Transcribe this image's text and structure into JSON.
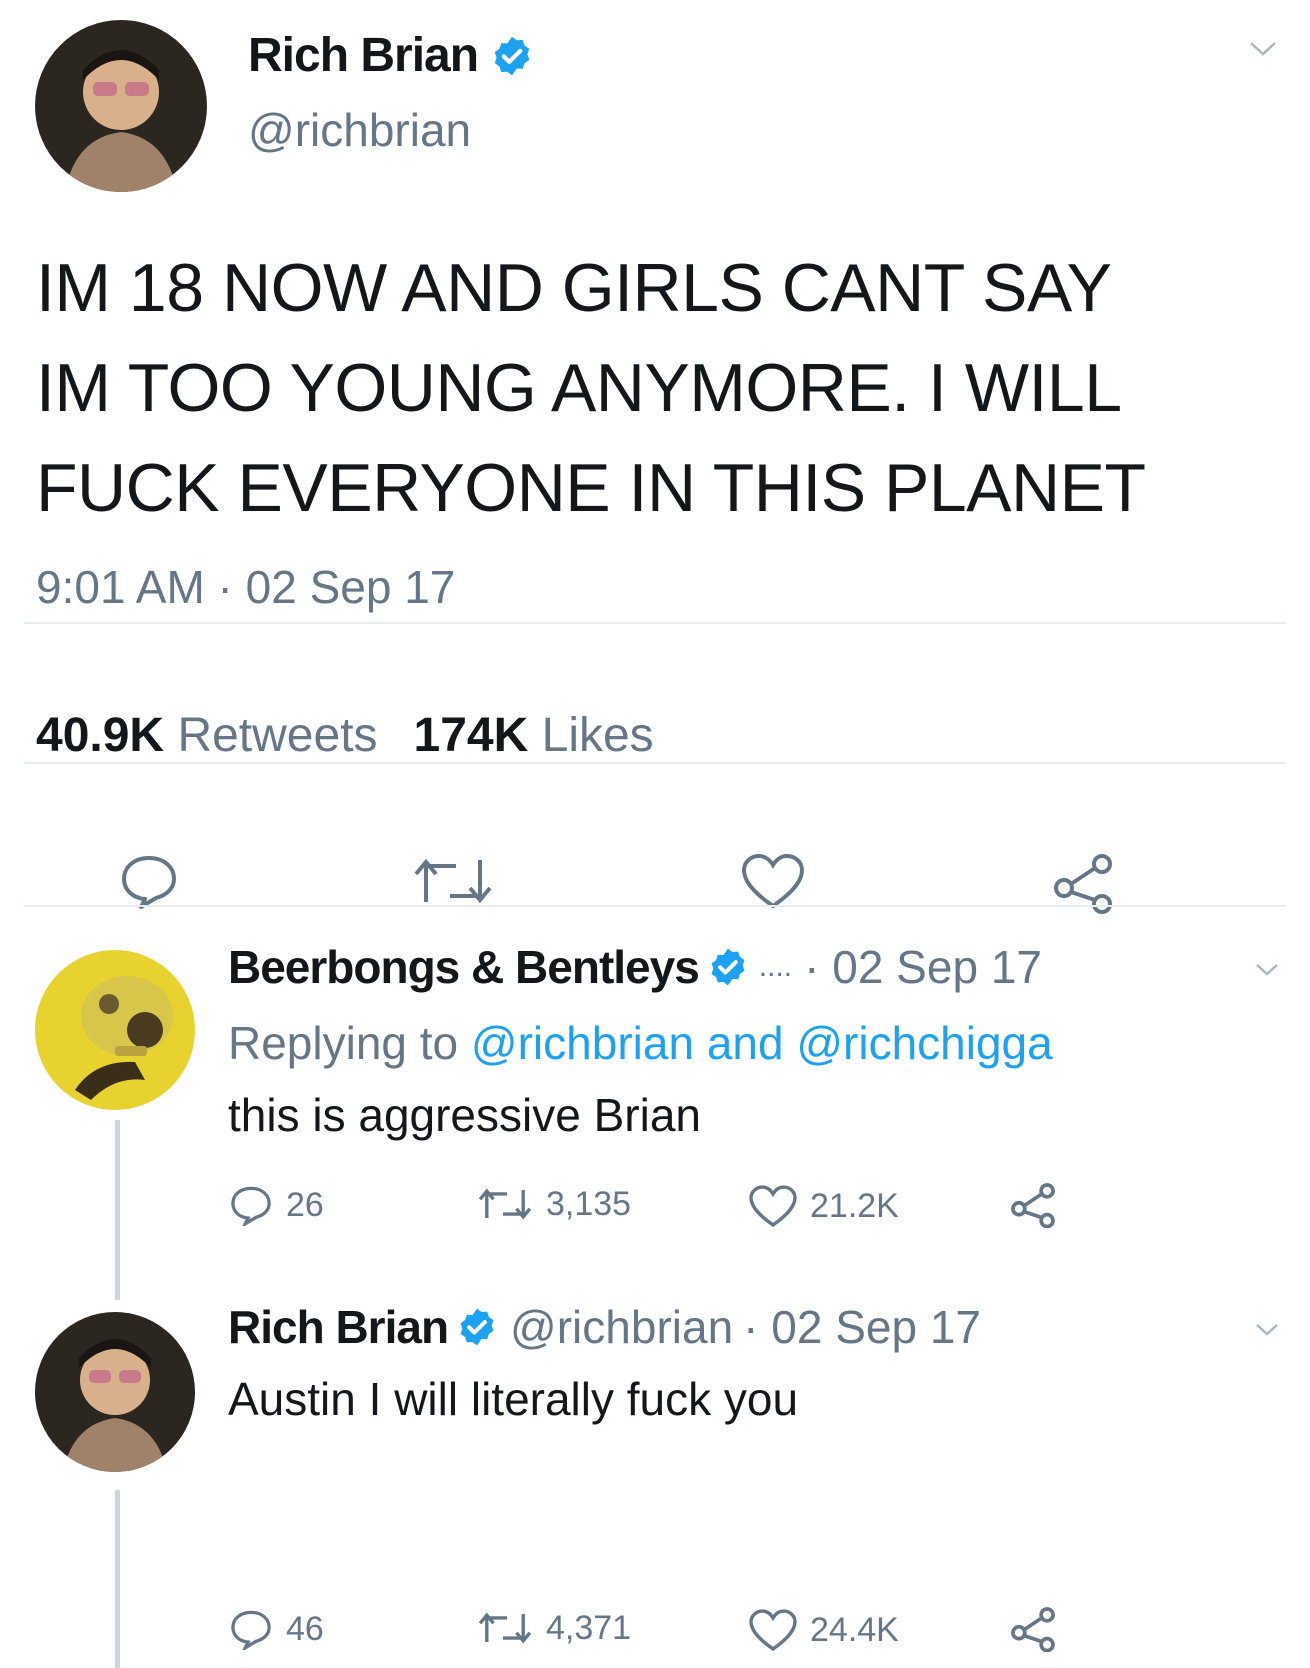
{
  "main_tweet": {
    "author_name": "Rich Brian",
    "handle": "@richbrian",
    "text": "IM 18 NOW AND GIRLS CANT SAY\nIM TOO YOUNG ANYMORE. I WILL\nFUCK EVERYONE IN THIS PLANET",
    "timestamp": "9:01 AM · 02 Sep 17",
    "retweets_count": "40.9K",
    "retweets_label": "Retweets",
    "likes_count": "174K",
    "likes_label": "Likes",
    "actions": [
      "reply-icon",
      "retweet-icon",
      "like-icon",
      "share-icon"
    ]
  },
  "replies": [
    {
      "author_name": "Beerbongs & Bentleys",
      "handle": "....",
      "date": "· 02 Sep 17",
      "replying_label": "Replying to",
      "replying_to_1": "@richbrian",
      "replying_and": "and",
      "replying_to_2": "@richchigga",
      "text": "this is aggressive Brian",
      "reply_count": "26",
      "retweet_count": "3,135",
      "like_count": "21.2K"
    },
    {
      "author_name": "Rich Brian",
      "handle": "@richbrian",
      "date": "· 02 Sep 17",
      "text": "Austin I will literally fuck you",
      "reply_count": "46",
      "retweet_count": "4,371",
      "like_count": "24.4K"
    }
  ],
  "colors": {
    "verified": "#1da1f2",
    "text": "#14171a",
    "secondary": "#657786",
    "divider": "#e6ecf0"
  }
}
